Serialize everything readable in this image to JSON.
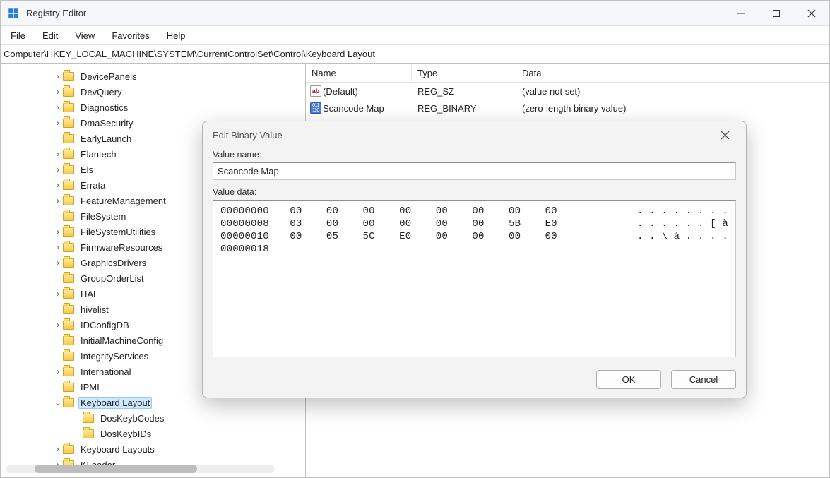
{
  "window": {
    "title": "Registry Editor",
    "controls": {
      "min": "–",
      "max": "☐",
      "close": "✕"
    }
  },
  "menubar": [
    "File",
    "Edit",
    "View",
    "Favorites",
    "Help"
  ],
  "address": "Computer\\HKEY_LOCAL_MACHINE\\SYSTEM\\CurrentControlSet\\Control\\Keyboard Layout",
  "tree": [
    {
      "expand": ">",
      "label": "DevicePanels"
    },
    {
      "expand": ">",
      "label": "DevQuery"
    },
    {
      "expand": ">",
      "label": "Diagnostics"
    },
    {
      "expand": ">",
      "label": "DmaSecurity"
    },
    {
      "expand": "",
      "label": "EarlyLaunch"
    },
    {
      "expand": ">",
      "label": "Elantech"
    },
    {
      "expand": ">",
      "label": "Els"
    },
    {
      "expand": ">",
      "label": "Errata"
    },
    {
      "expand": ">",
      "label": "FeatureManagement"
    },
    {
      "expand": "",
      "label": "FileSystem"
    },
    {
      "expand": ">",
      "label": "FileSystemUtilities"
    },
    {
      "expand": ">",
      "label": "FirmwareResources"
    },
    {
      "expand": ">",
      "label": "GraphicsDrivers"
    },
    {
      "expand": "",
      "label": "GroupOrderList"
    },
    {
      "expand": ">",
      "label": "HAL"
    },
    {
      "expand": "",
      "label": "hivelist"
    },
    {
      "expand": ">",
      "label": "IDConfigDB"
    },
    {
      "expand": "",
      "label": "InitialMachineConfig"
    },
    {
      "expand": "",
      "label": "IntegrityServices"
    },
    {
      "expand": ">",
      "label": "International"
    },
    {
      "expand": "",
      "label": "IPMI"
    },
    {
      "expand": "v",
      "label": "Keyboard Layout",
      "selected": true,
      "children": [
        {
          "label": "DosKeybCodes"
        },
        {
          "label": "DosKeybIDs"
        }
      ]
    },
    {
      "expand": ">",
      "label": "Keyboard Layouts"
    },
    {
      "expand": ">",
      "label": "KLoader"
    }
  ],
  "list": {
    "headers": {
      "name": "Name",
      "type": "Type",
      "data": "Data"
    },
    "rows": [
      {
        "icon": "ab",
        "name": "(Default)",
        "type": "REG_SZ",
        "data": "(value not set)"
      },
      {
        "icon": "bin",
        "name": "Scancode Map",
        "type": "REG_BINARY",
        "data": "(zero-length binary value)"
      }
    ]
  },
  "dialog": {
    "title": "Edit Binary Value",
    "value_name_label": "Value name:",
    "value_name": "Scancode Map",
    "value_data_label": "Value data:",
    "hex": [
      {
        "off": "00000000",
        "b": [
          "00",
          "00",
          "00",
          "00",
          "00",
          "00",
          "00",
          "00"
        ],
        "a": ". . . . . . . ."
      },
      {
        "off": "00000008",
        "b": [
          "03",
          "00",
          "00",
          "00",
          "00",
          "00",
          "5B",
          "E0"
        ],
        "a": ". . . . . . [ à"
      },
      {
        "off": "00000010",
        "b": [
          "00",
          "05",
          "5C",
          "E0",
          "00",
          "00",
          "00",
          "00"
        ],
        "a": ". . \\ à . . . ."
      },
      {
        "off": "00000018",
        "b": [],
        "a": ""
      }
    ],
    "ok": "OK",
    "cancel": "Cancel"
  }
}
